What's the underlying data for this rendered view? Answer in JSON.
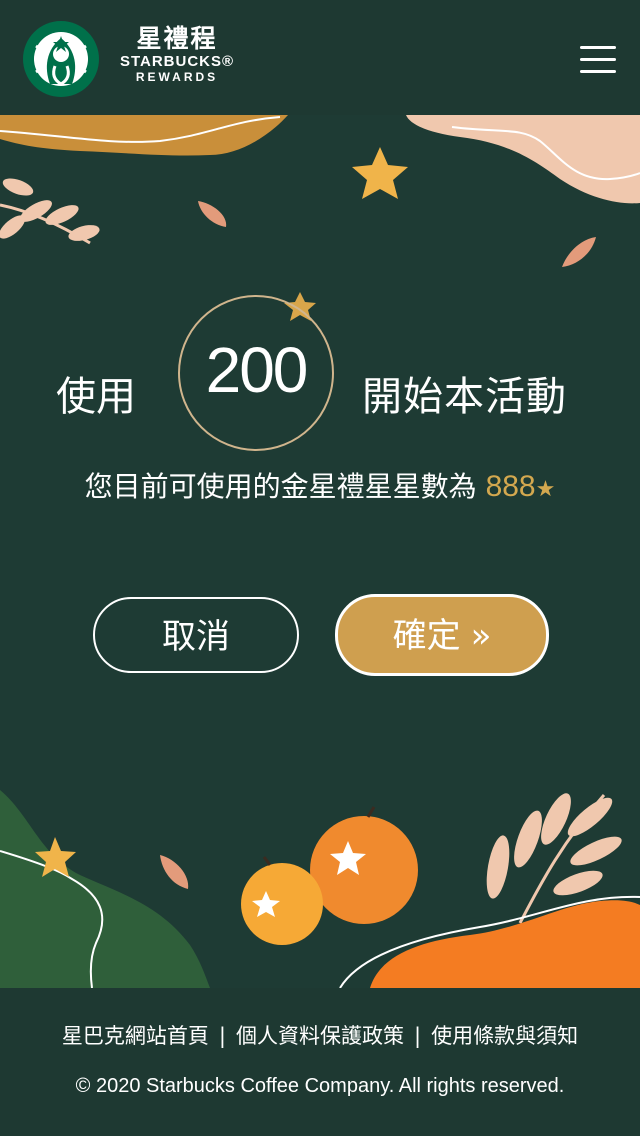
{
  "header": {
    "brand_cn": "星禮程",
    "brand_en": "STARBUCKS®",
    "brand_sub": "REWARDS"
  },
  "redeem": {
    "prefix": "使用",
    "points": "200",
    "suffix": "開始本活動",
    "balance_text": "您目前可使用的金星禮星星數為",
    "balance_value": "888",
    "star_glyph": "★"
  },
  "buttons": {
    "cancel": "取消",
    "confirm": "確定",
    "confirm_arrow": "»"
  },
  "footer": {
    "links": [
      "星巴克網站首頁",
      "個人資料保護政策",
      "使用條款與須知"
    ],
    "separator": "|",
    "copyright": "© 2020 Starbucks Coffee Company. All rights reserved."
  },
  "colors": {
    "background": "#1e3932",
    "gold": "#cf9f4f",
    "orange": "#f2822f",
    "green_hill": "#2f5f3a"
  }
}
